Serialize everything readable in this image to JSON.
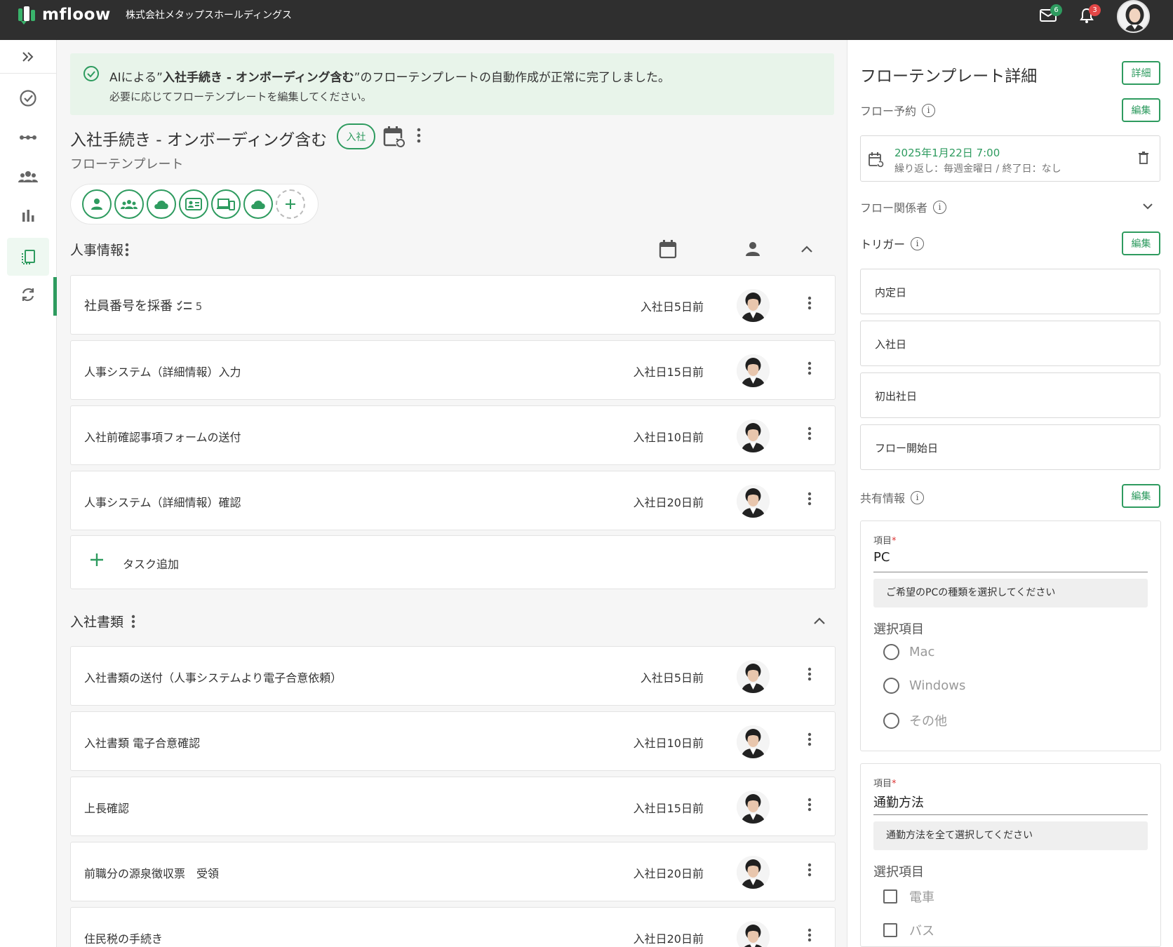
{
  "header": {
    "logo_text": "mfloow",
    "company_name": "株式会社メタップスホールディングス",
    "mail_badge": "6",
    "notification_badge": "3",
    "accent_color": "#2e9b5f"
  },
  "banner": {
    "line1_prefix": "AIによる”",
    "line1_bold": "入社手続き - オンボーディング含む",
    "line1_suffix": "”のフローテンプレートの自動作成が正常に完了しました。",
    "line2": "必要に応じてフローテンプレートを編集してください。"
  },
  "flow": {
    "title": "入社手続き - オンボーディング含む",
    "tag": "入社",
    "subtitle": "フローテンプレート"
  },
  "sections": [
    {
      "title": "人事情報",
      "tasks": [
        {
          "name": "社員番号を採番",
          "subtasks": "5",
          "due": "入社日5日前"
        },
        {
          "name": "人事システム（詳細情報）入力",
          "due": "入社日15日前"
        },
        {
          "name": "入社前確認事項フォームの送付",
          "due": "入社日10日前"
        },
        {
          "name": "人事システム（詳細情報）確認",
          "due": "入社日20日前"
        }
      ],
      "add_task_label": "タスク追加"
    },
    {
      "title": "入社書類",
      "tasks": [
        {
          "name": "入社書類の送付（人事システムより電子合意依頼）",
          "due": "入社日5日前"
        },
        {
          "name": "入社書類 電子合意確認",
          "due": "入社日10日前"
        },
        {
          "name": "上長確認",
          "due": "入社日15日前"
        },
        {
          "name": "前職分の源泉徴収票　受領",
          "due": "入社日20日前"
        },
        {
          "name": "住民税の手続き",
          "due": "入社日20日前"
        }
      ]
    }
  ],
  "right_panel": {
    "title": "フローテンプレート詳細",
    "detail_button": "詳細",
    "edit_button": "編集",
    "schedule_label": "フロー予約",
    "schedule_date": "2025年1月22日 7:00",
    "schedule_repeat": "繰り返し：毎週金曜日 / 終了日：なし",
    "stakeholders_label": "フロー関係者",
    "trigger_label": "トリガー",
    "triggers": [
      "内定日",
      "入社日",
      "初出社日",
      "フロー開始日"
    ],
    "shared_label": "共有情報",
    "fields": [
      {
        "label": "項目",
        "required_mark": "*",
        "value": "PC",
        "hint": "ご希望のPCの種類を選択してください",
        "options_title": "選択項目",
        "options": [
          "Mac",
          "Windows",
          "その他"
        ]
      },
      {
        "label": "項目",
        "required_mark": "*",
        "value": "通勤方法",
        "hint": "通勤方法を全て選択してください",
        "options_title": "選択項目",
        "options": [
          "電車",
          "バス"
        ]
      }
    ]
  }
}
